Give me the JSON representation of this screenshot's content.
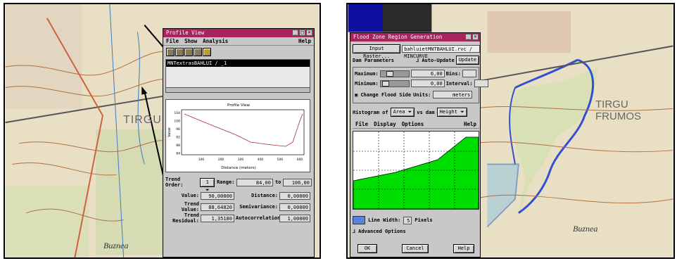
{
  "colors": {
    "title_bar": "#a8245c",
    "window_bg": "#c8c8c8",
    "fill_green": "#00dd00",
    "region_line": "#3050d0"
  },
  "left": {
    "map_labels": {
      "town": "TIRGU F",
      "village": "Buznea"
    },
    "profile_window": {
      "title": "Profile View",
      "menu": [
        "File",
        "Show",
        "Analysis"
      ],
      "help": "Help",
      "layer_item": "MNTextrasBAHLUI / _1",
      "graph": {
        "title": "Profile View",
        "xlabel": "Distance (meters)",
        "ylabel": "Value",
        "xticks": [
          "100",
          "200",
          "300",
          "400",
          "500",
          "600"
        ],
        "yticks": [
          "104",
          "100",
          "96",
          "92",
          "88",
          "84"
        ]
      },
      "trend_order_label": "Trend Order:",
      "trend_order_value": "1",
      "range_label": "Range:",
      "range_from": "84,00",
      "range_to_label": "to",
      "range_to": "106,00",
      "stats": [
        {
          "l1": "Value:",
          "v1": "90,00000",
          "l2": "Distance:",
          "v2": "0,00000"
        },
        {
          "l1": "Trend Value:",
          "v1": "88,64820",
          "l2": "Semivariance:",
          "v2": "0,00000"
        },
        {
          "l1": "Trend Residual:",
          "v1": "1,35180",
          "l2": "Autocorrelation:",
          "v2": "1,00000"
        }
      ]
    }
  },
  "right": {
    "map_labels": {
      "town": "TIRGU FRUMOS",
      "village": "Buznea"
    },
    "flood_window": {
      "title": "Flood Zone Region Generation",
      "input_raster_button": "Input Raster...",
      "input_raster_value": "bahluietMNTBAHLUI.rvc / MINCURVE",
      "dam_params_label": "Dam Parameters",
      "auto_update_label": "Auto-Update",
      "update_button": "Update",
      "maximum_label": "Maximum:",
      "maximum_value": "6,00",
      "bins_label": "Bins:",
      "minimum_label": "Minimum:",
      "minimum_value": "0,00",
      "interval_label": "Interval:",
      "change_flood_label": "Change Flood Side",
      "units_label": "Units:",
      "units_value": "meters",
      "histogram_of_label": "Histogram of",
      "histogram_of_value": "Area",
      "vs_dam_label": "vs dam",
      "vs_dam_value": "Height",
      "hist_menu": [
        "File",
        "Display",
        "Options"
      ],
      "hist_help": "Help",
      "line_width_label": "Line Width:",
      "line_width_value": "5",
      "pixels_label": "Pixels",
      "advanced_label": "Advanced Options",
      "ok_button": "OK",
      "cancel_button": "Cancel",
      "help_button": "Help"
    }
  }
}
